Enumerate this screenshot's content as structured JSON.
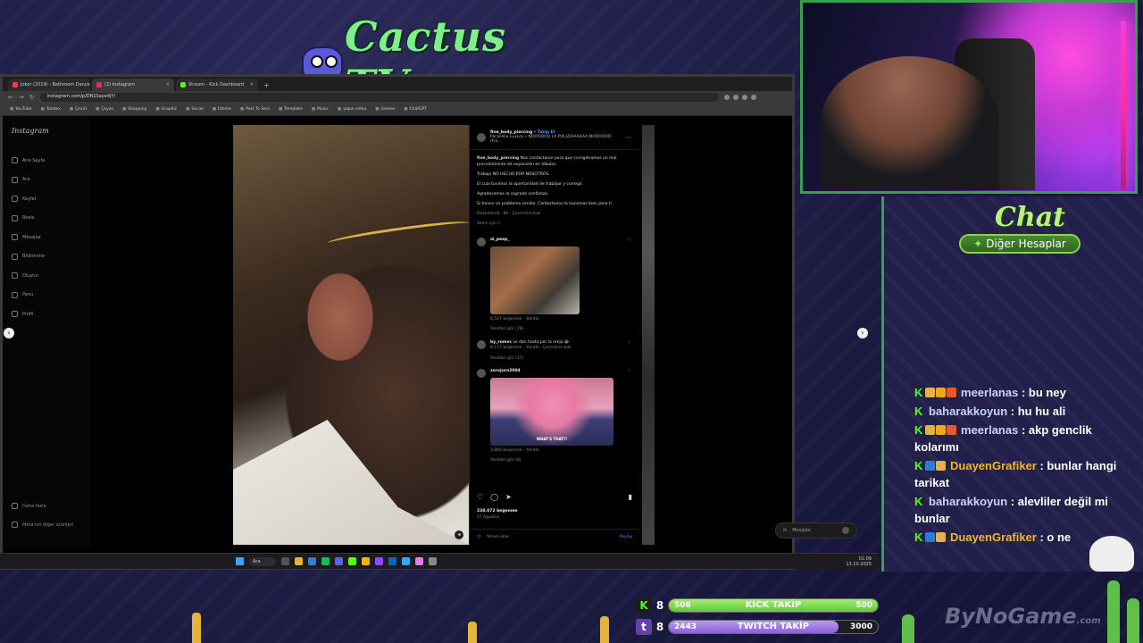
{
  "brand": {
    "name": "Cactus TV"
  },
  "browser": {
    "tabs": [
      {
        "label": "Joker (2019) - Bathroom Dance",
        "color": "#ff3b3b"
      },
      {
        "label": "(2) Instagram",
        "color": "#e1306c",
        "active": true
      },
      {
        "label": "Stream - Kick Dashboard",
        "color": "#53fc18"
      }
    ],
    "new_tab": "+",
    "url": "instagram.com/p/DN1Saye4jY/",
    "bookmarks": [
      "YouTube",
      "Yandex",
      "Çeviri",
      "Çeyzo",
      "Shopping",
      "Graphic",
      "Social",
      "İzleme",
      "Post To Sers",
      "Template",
      "Music",
      "yapın video",
      "Games",
      "ChatGPT"
    ]
  },
  "instagram": {
    "logo": "Instagram",
    "nav": [
      "Ana Sayfa",
      "Ara",
      "Keşfet",
      "Reels",
      "Mesajlar",
      "Bildirimler",
      "Oluştur",
      "Panu",
      "Profil"
    ],
    "bottom_nav": [
      "Daha fazla",
      "Meta'nın diğer ürünleri"
    ],
    "post": {
      "author": "fine_body_piercing",
      "follow": "Takip Et",
      "audio": "Paracelia Luxury • NOOOOOO LA POLIZIAAAAAA NOOOOOO (fra...",
      "caption_author": "fine_body_piercing",
      "caption_lines": [
        "Nos contactaron para que corrigiéramos un mal procedimiento de expansión en lóbulos.",
        "Trabajo NO HECHO POR NOSOTROS.",
        "El cual tuvimos la oportunidad de trabajar y corregir.",
        "Agradecemos la sagrada confianza.",
        "Si tienes un problema similar. Contactanos lo hacemos bien para ti"
      ],
      "caption_meta": "Düzenlendi · 6h · Çevirisine bak",
      "for_you": "Senin için ▽",
      "comments": [
        {
          "user": "al_peep_",
          "text": "",
          "meta": "8,547 beğenme · Yanıtla",
          "replies": "Yanıtları gör (78)",
          "gif": "gif1"
        },
        {
          "user": "by_romvc",
          "text": "Le dan hasta por la oreja 😭",
          "meta": "8,117 beğenme · Yanıtla · Çevirisine bak",
          "replies": "Yanıtları gör (17)"
        },
        {
          "user": "zorojuro2004",
          "text": "",
          "meta": "3,860 beğenme · Yanıtla",
          "replies": "Yanıtları gör (8)",
          "gif": "gif2",
          "gif_text": "WHAT'S THAT?!"
        }
      ],
      "likes": "238.072 beğenme",
      "age": "27 Ağustos",
      "add_comment": "Yorum ekle...",
      "post_btn": "Paylaş"
    },
    "messages_pill": "Mesajlar"
  },
  "taskbar": {
    "search": "Ara",
    "time": "01:09",
    "date": "13.10.2025"
  },
  "chat": {
    "title": "Chat",
    "banner": "Diğer Hesaplar",
    "messages": [
      {
        "user": "meerlanas",
        "text": ": bu ney",
        "color": "#c9d1ff",
        "badges": [
          "#e3b04b",
          "#f2a81c",
          "#e55a2a"
        ]
      },
      {
        "user": "baharakkoyun",
        "text": ": hu hu ali",
        "color": "#c9d1ff",
        "badges": []
      },
      {
        "user": "meerlanas",
        "text": ": akp genclik kolarımı",
        "color": "#c9d1ff",
        "badges": [
          "#e3b04b",
          "#f2a81c",
          "#e55a2a"
        ]
      },
      {
        "user": "DuayenGrafiker",
        "text": ": bunlar hangi tarikat",
        "color": "#f5b524",
        "badges": [
          "#2e7bd6",
          "#e3b04b"
        ]
      },
      {
        "user": "baharakkoyun",
        "text": ": alevliler değil mi bunlar",
        "color": "#c9d1ff",
        "badges": []
      },
      {
        "user": "DuayenGrafiker",
        "text": ": o ne",
        "color": "#f5b524",
        "badges": [
          "#2e7bd6",
          "#e3b04b"
        ]
      }
    ]
  },
  "follow_goals": {
    "kick": {
      "platform": "K",
      "current": "506",
      "label": "KICK TAKİP",
      "goal": "500",
      "progress": 1.0,
      "prefix": "8"
    },
    "twitch": {
      "platform": "t",
      "current": "2443",
      "label": "TWITCH TAKİP",
      "goal": "3000",
      "progress": 0.81,
      "prefix": "8"
    }
  },
  "watermark": {
    "main": "ByNoGame",
    "tld": ".com"
  }
}
